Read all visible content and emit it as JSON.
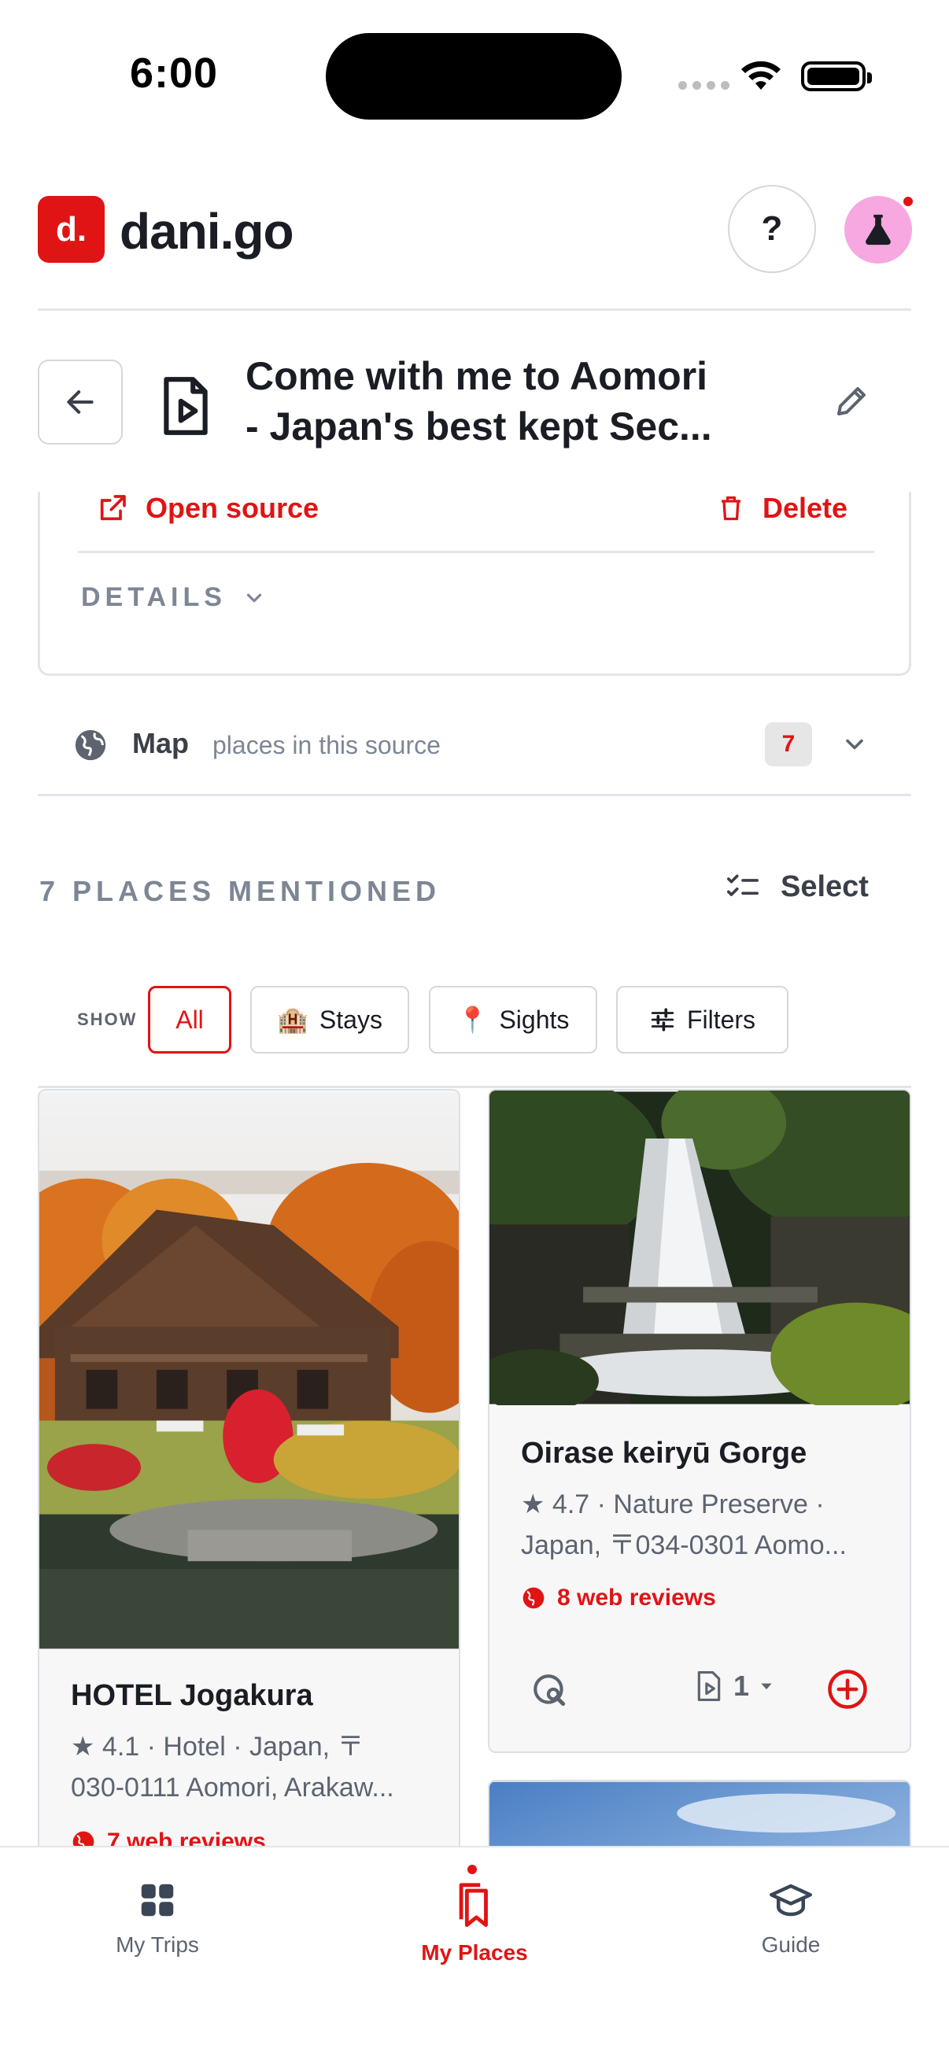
{
  "status_bar": {
    "time": "6:00"
  },
  "app": {
    "logo_mark": "d.",
    "logo_text": "dani.go",
    "help_label": "?"
  },
  "source": {
    "title_line1": "Come with me to Aomori",
    "title_line2": "- Japan's best kept Sec...",
    "open_source_label": "Open source",
    "delete_label": "Delete",
    "details_label": "DETAILS"
  },
  "map": {
    "label": "Map",
    "sublabel": "places in this source",
    "count": "7"
  },
  "places": {
    "heading": "7 PLACES MENTIONED",
    "select_label": "Select",
    "show_label": "SHOW",
    "filters": [
      {
        "label": "All",
        "icon": ""
      },
      {
        "label": "Stays",
        "icon": "🏨"
      },
      {
        "label": "Sights",
        "icon": "📍"
      },
      {
        "label": "Filters",
        "icon": "sliders-icon"
      }
    ],
    "items": [
      {
        "name": "HOTEL Jogakura",
        "meta_line1": "★ 4.1  ·  Hotel  ·  Japan, 〒",
        "meta_line2": "030-0111 Aomori, Arakaw...",
        "reviews": "7 web reviews"
      },
      {
        "name": "Oirase keiryū Gorge",
        "meta_line1": "★ 4.7  ·  Nature Preserve  ·",
        "meta_line2": "Japan, 〒034-0301 Aomo...",
        "reviews": "8 web reviews",
        "sources_count": "1"
      }
    ]
  },
  "nav": {
    "items": [
      {
        "label": "My Trips"
      },
      {
        "label": "My Places"
      },
      {
        "label": "Guide"
      }
    ]
  },
  "colors": {
    "accent": "#e01414",
    "muted": "#7d8694",
    "labs": "#f7a8e0"
  }
}
